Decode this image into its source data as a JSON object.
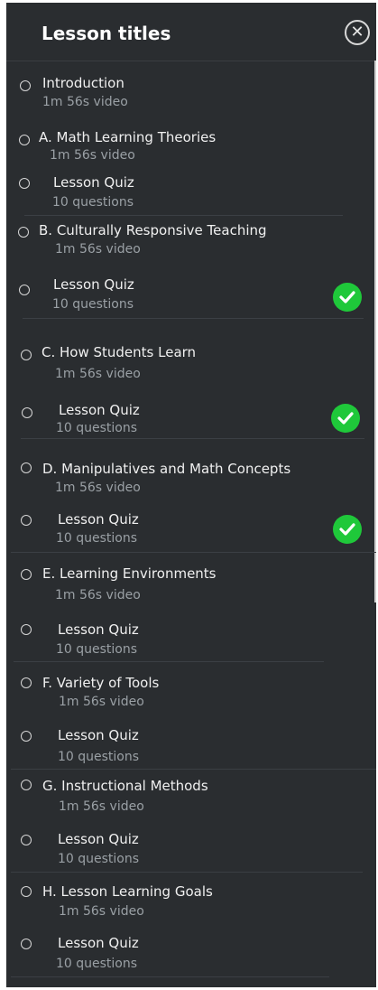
{
  "header": {
    "title": "Lesson titles",
    "close_icon": "close-icon"
  },
  "items": [
    {
      "title": "Introduction",
      "sub": "1m 56s video",
      "completed": false
    },
    {
      "title": "A. Math Learning Theories",
      "sub": "1m 56s video",
      "completed": false
    },
    {
      "title": "Lesson Quiz",
      "sub": "10 questions",
      "completed": false
    },
    {
      "title": "B. Culturally Responsive Teaching",
      "sub": "1m 56s video",
      "completed": false
    },
    {
      "title": "Lesson Quiz",
      "sub": "10 questions",
      "completed": true
    },
    {
      "title": "C. How Students Learn",
      "sub": "1m 56s video",
      "completed": false
    },
    {
      "title": "Lesson Quiz",
      "sub": "10 questions",
      "completed": true
    },
    {
      "title": "D. Manipulatives and Math Concepts",
      "sub": "1m 56s video",
      "completed": false
    },
    {
      "title": "Lesson Quiz",
      "sub": "10 questions",
      "completed": true
    },
    {
      "title": "E. Learning Environments",
      "sub": "1m 56s video",
      "completed": false
    },
    {
      "title": "Lesson Quiz",
      "sub": "10 questions",
      "completed": false
    },
    {
      "title": "F. Variety of Tools",
      "sub": "1m 56s video",
      "completed": false
    },
    {
      "title": "Lesson Quiz",
      "sub": "10 questions",
      "completed": false
    },
    {
      "title": "G. Instructional Methods",
      "sub": "1m 56s video",
      "completed": false
    },
    {
      "title": "Lesson Quiz",
      "sub": "10 questions",
      "completed": false
    },
    {
      "title": "H. Lesson Learning Goals",
      "sub": "1m 56s video",
      "completed": false
    },
    {
      "title": "Lesson Quiz",
      "sub": "10 questions",
      "completed": false
    }
  ],
  "colors": {
    "panel": "#2a2d30",
    "check": "#1fc83a",
    "text": "#f0f0f0",
    "subtext": "#9aa0a5"
  }
}
